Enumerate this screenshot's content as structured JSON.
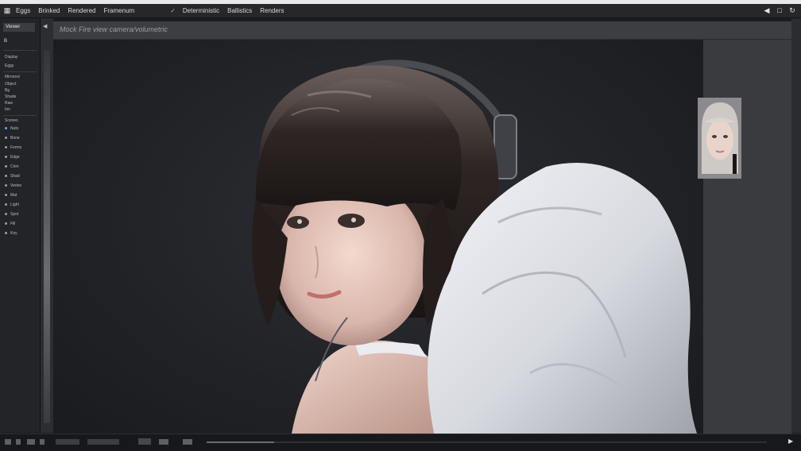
{
  "menubar": {
    "items": [
      "Eggs",
      "Brinked",
      "Rendered",
      "Framenum"
    ],
    "secondary": [
      "Deterministic",
      "Ballistics",
      "Renders"
    ],
    "right_icons": [
      "play-back-icon",
      "window-icon",
      "refresh-icon"
    ]
  },
  "left_panel": {
    "tab_label": "Viewer",
    "tool_label": "B",
    "section_label": "Scenes",
    "rows": [
      "Display",
      "Eggy",
      "Mirrored",
      "Object",
      "Bg",
      "Shade",
      "Raw",
      "Ion",
      "Mat",
      "Light",
      "Spot",
      "Fill",
      "Key",
      "Rim",
      "Spec",
      "Bump",
      "Diff",
      "Color",
      "Sky",
      "Depth"
    ],
    "layer_rows": [
      "Nuts",
      "Bone",
      "Forms",
      "Edge",
      "Crim",
      "Shad",
      "Vertex"
    ]
  },
  "canvas": {
    "header_title": "Mock Fire view camera/volumetric"
  },
  "status": {
    "progress": 0.12
  },
  "colors": {
    "background": "#1c1d20",
    "panel": "#232428",
    "header": "#3d3e43",
    "right_panel": "#3a3b3f"
  }
}
